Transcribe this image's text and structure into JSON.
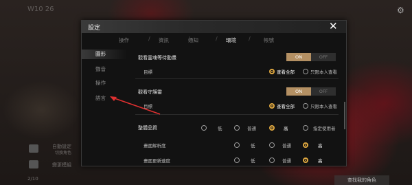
{
  "background": {
    "top_left_text": "W10 26",
    "auto_setting_label": "自動設定",
    "auto_setting_sub": "切換角色",
    "dungeon_label": "變更模組",
    "bottom_left_text": "2/10",
    "bottom_right_button": "查找我的角色"
  },
  "modal": {
    "title": "設定",
    "close_icon": "close-icon",
    "tabs": [
      {
        "label": "操作",
        "active": false
      },
      {
        "label": "資訊",
        "active": false
      },
      {
        "label": "通知",
        "active": false
      },
      {
        "label": "環境",
        "active": true
      },
      {
        "label": "帳號",
        "active": false
      }
    ],
    "sidebar": [
      {
        "label": "圖形",
        "active": true
      },
      {
        "label": "聲音",
        "active": false
      },
      {
        "label": "操作",
        "active": false
      },
      {
        "label": "語言",
        "active": false
      }
    ],
    "sections": {
      "boss_anim": {
        "title": "觀看靈魂等待動畫",
        "on": "ON",
        "off": "OFF",
        "target_label": "目標",
        "opt_all": "查看全部",
        "opt_self": "只限本人查看"
      },
      "guardian": {
        "title": "觀看守護靈",
        "on": "ON",
        "off": "OFF",
        "target_label": "目標",
        "opt_all": "查看全部",
        "opt_self": "只限本人查看"
      },
      "quality": {
        "title": "整體品質",
        "opt_low": "低",
        "opt_normal": "普通",
        "opt_high": "高",
        "opt_custom": "指定使用者",
        "resolution_label": "畫面解析度",
        "res_low": "低",
        "res_normal": "普通",
        "res_high": "高",
        "next_label": "畫面更新速度",
        "next_low": "低",
        "next_normal": "普通",
        "next_high": "高"
      }
    }
  },
  "colors": {
    "accent": "#b49063",
    "radio_selected": "#e0a840",
    "annotation_arrow": "#e03030"
  }
}
